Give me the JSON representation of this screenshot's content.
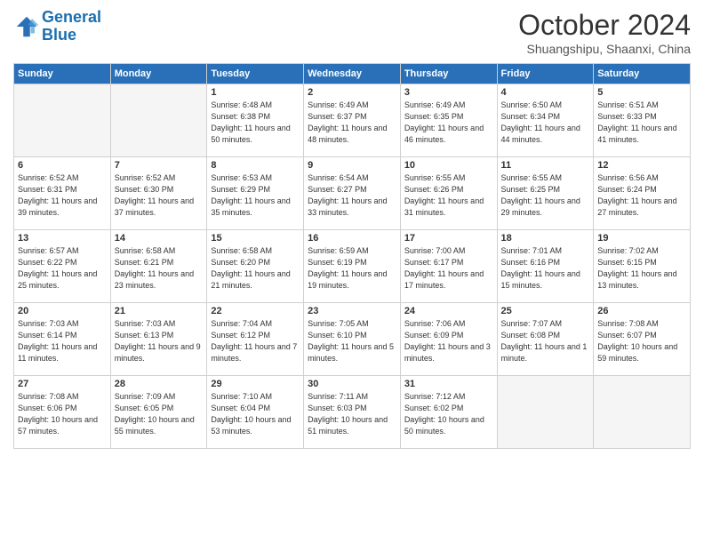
{
  "header": {
    "logo_line1": "General",
    "logo_line2": "Blue",
    "month": "October 2024",
    "location": "Shuangshipu, Shaanxi, China"
  },
  "days_of_week": [
    "Sunday",
    "Monday",
    "Tuesday",
    "Wednesday",
    "Thursday",
    "Friday",
    "Saturday"
  ],
  "weeks": [
    [
      {
        "day": "",
        "empty": true
      },
      {
        "day": "",
        "empty": true
      },
      {
        "day": "1",
        "sunrise": "6:48 AM",
        "sunset": "6:38 PM",
        "daylight": "11 hours and 50 minutes."
      },
      {
        "day": "2",
        "sunrise": "6:49 AM",
        "sunset": "6:37 PM",
        "daylight": "11 hours and 48 minutes."
      },
      {
        "day": "3",
        "sunrise": "6:49 AM",
        "sunset": "6:35 PM",
        "daylight": "11 hours and 46 minutes."
      },
      {
        "day": "4",
        "sunrise": "6:50 AM",
        "sunset": "6:34 PM",
        "daylight": "11 hours and 44 minutes."
      },
      {
        "day": "5",
        "sunrise": "6:51 AM",
        "sunset": "6:33 PM",
        "daylight": "11 hours and 41 minutes."
      }
    ],
    [
      {
        "day": "6",
        "sunrise": "6:52 AM",
        "sunset": "6:31 PM",
        "daylight": "11 hours and 39 minutes."
      },
      {
        "day": "7",
        "sunrise": "6:52 AM",
        "sunset": "6:30 PM",
        "daylight": "11 hours and 37 minutes."
      },
      {
        "day": "8",
        "sunrise": "6:53 AM",
        "sunset": "6:29 PM",
        "daylight": "11 hours and 35 minutes."
      },
      {
        "day": "9",
        "sunrise": "6:54 AM",
        "sunset": "6:27 PM",
        "daylight": "11 hours and 33 minutes."
      },
      {
        "day": "10",
        "sunrise": "6:55 AM",
        "sunset": "6:26 PM",
        "daylight": "11 hours and 31 minutes."
      },
      {
        "day": "11",
        "sunrise": "6:55 AM",
        "sunset": "6:25 PM",
        "daylight": "11 hours and 29 minutes."
      },
      {
        "day": "12",
        "sunrise": "6:56 AM",
        "sunset": "6:24 PM",
        "daylight": "11 hours and 27 minutes."
      }
    ],
    [
      {
        "day": "13",
        "sunrise": "6:57 AM",
        "sunset": "6:22 PM",
        "daylight": "11 hours and 25 minutes."
      },
      {
        "day": "14",
        "sunrise": "6:58 AM",
        "sunset": "6:21 PM",
        "daylight": "11 hours and 23 minutes."
      },
      {
        "day": "15",
        "sunrise": "6:58 AM",
        "sunset": "6:20 PM",
        "daylight": "11 hours and 21 minutes."
      },
      {
        "day": "16",
        "sunrise": "6:59 AM",
        "sunset": "6:19 PM",
        "daylight": "11 hours and 19 minutes."
      },
      {
        "day": "17",
        "sunrise": "7:00 AM",
        "sunset": "6:17 PM",
        "daylight": "11 hours and 17 minutes."
      },
      {
        "day": "18",
        "sunrise": "7:01 AM",
        "sunset": "6:16 PM",
        "daylight": "11 hours and 15 minutes."
      },
      {
        "day": "19",
        "sunrise": "7:02 AM",
        "sunset": "6:15 PM",
        "daylight": "11 hours and 13 minutes."
      }
    ],
    [
      {
        "day": "20",
        "sunrise": "7:03 AM",
        "sunset": "6:14 PM",
        "daylight": "11 hours and 11 minutes."
      },
      {
        "day": "21",
        "sunrise": "7:03 AM",
        "sunset": "6:13 PM",
        "daylight": "11 hours and 9 minutes."
      },
      {
        "day": "22",
        "sunrise": "7:04 AM",
        "sunset": "6:12 PM",
        "daylight": "11 hours and 7 minutes."
      },
      {
        "day": "23",
        "sunrise": "7:05 AM",
        "sunset": "6:10 PM",
        "daylight": "11 hours and 5 minutes."
      },
      {
        "day": "24",
        "sunrise": "7:06 AM",
        "sunset": "6:09 PM",
        "daylight": "11 hours and 3 minutes."
      },
      {
        "day": "25",
        "sunrise": "7:07 AM",
        "sunset": "6:08 PM",
        "daylight": "11 hours and 1 minute."
      },
      {
        "day": "26",
        "sunrise": "7:08 AM",
        "sunset": "6:07 PM",
        "daylight": "10 hours and 59 minutes."
      }
    ],
    [
      {
        "day": "27",
        "sunrise": "7:08 AM",
        "sunset": "6:06 PM",
        "daylight": "10 hours and 57 minutes."
      },
      {
        "day": "28",
        "sunrise": "7:09 AM",
        "sunset": "6:05 PM",
        "daylight": "10 hours and 55 minutes."
      },
      {
        "day": "29",
        "sunrise": "7:10 AM",
        "sunset": "6:04 PM",
        "daylight": "10 hours and 53 minutes."
      },
      {
        "day": "30",
        "sunrise": "7:11 AM",
        "sunset": "6:03 PM",
        "daylight": "10 hours and 51 minutes."
      },
      {
        "day": "31",
        "sunrise": "7:12 AM",
        "sunset": "6:02 PM",
        "daylight": "10 hours and 50 minutes."
      },
      {
        "day": "",
        "empty": true
      },
      {
        "day": "",
        "empty": true
      }
    ]
  ]
}
